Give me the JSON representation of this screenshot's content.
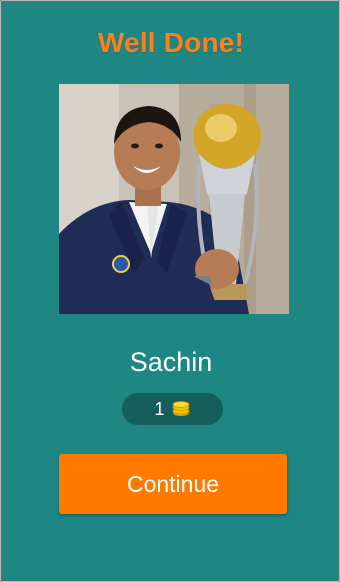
{
  "header": {
    "title": "Well Done!"
  },
  "result": {
    "answer": "Sachin",
    "reward_count": "1",
    "reward_icon": "coins-icon"
  },
  "actions": {
    "continue_label": "Continue"
  },
  "colors": {
    "background": "#1e8683",
    "title": "#ff7f1a",
    "badge": "#155e5b",
    "button": "#ff7b00",
    "coin": "#f5c400"
  }
}
